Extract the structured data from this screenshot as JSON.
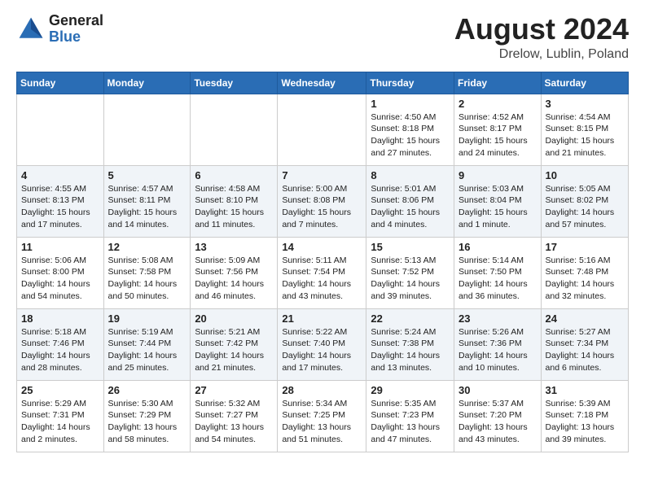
{
  "header": {
    "logo_general": "General",
    "logo_blue": "Blue",
    "title": "August 2024",
    "subtitle": "Drelow, Lublin, Poland"
  },
  "weekdays": [
    "Sunday",
    "Monday",
    "Tuesday",
    "Wednesday",
    "Thursday",
    "Friday",
    "Saturday"
  ],
  "weeks": [
    [
      {
        "day": "",
        "info": ""
      },
      {
        "day": "",
        "info": ""
      },
      {
        "day": "",
        "info": ""
      },
      {
        "day": "",
        "info": ""
      },
      {
        "day": "1",
        "info": "Sunrise: 4:50 AM\nSunset: 8:18 PM\nDaylight: 15 hours\nand 27 minutes."
      },
      {
        "day": "2",
        "info": "Sunrise: 4:52 AM\nSunset: 8:17 PM\nDaylight: 15 hours\nand 24 minutes."
      },
      {
        "day": "3",
        "info": "Sunrise: 4:54 AM\nSunset: 8:15 PM\nDaylight: 15 hours\nand 21 minutes."
      }
    ],
    [
      {
        "day": "4",
        "info": "Sunrise: 4:55 AM\nSunset: 8:13 PM\nDaylight: 15 hours\nand 17 minutes."
      },
      {
        "day": "5",
        "info": "Sunrise: 4:57 AM\nSunset: 8:11 PM\nDaylight: 15 hours\nand 14 minutes."
      },
      {
        "day": "6",
        "info": "Sunrise: 4:58 AM\nSunset: 8:10 PM\nDaylight: 15 hours\nand 11 minutes."
      },
      {
        "day": "7",
        "info": "Sunrise: 5:00 AM\nSunset: 8:08 PM\nDaylight: 15 hours\nand 7 minutes."
      },
      {
        "day": "8",
        "info": "Sunrise: 5:01 AM\nSunset: 8:06 PM\nDaylight: 15 hours\nand 4 minutes."
      },
      {
        "day": "9",
        "info": "Sunrise: 5:03 AM\nSunset: 8:04 PM\nDaylight: 15 hours\nand 1 minute."
      },
      {
        "day": "10",
        "info": "Sunrise: 5:05 AM\nSunset: 8:02 PM\nDaylight: 14 hours\nand 57 minutes."
      }
    ],
    [
      {
        "day": "11",
        "info": "Sunrise: 5:06 AM\nSunset: 8:00 PM\nDaylight: 14 hours\nand 54 minutes."
      },
      {
        "day": "12",
        "info": "Sunrise: 5:08 AM\nSunset: 7:58 PM\nDaylight: 14 hours\nand 50 minutes."
      },
      {
        "day": "13",
        "info": "Sunrise: 5:09 AM\nSunset: 7:56 PM\nDaylight: 14 hours\nand 46 minutes."
      },
      {
        "day": "14",
        "info": "Sunrise: 5:11 AM\nSunset: 7:54 PM\nDaylight: 14 hours\nand 43 minutes."
      },
      {
        "day": "15",
        "info": "Sunrise: 5:13 AM\nSunset: 7:52 PM\nDaylight: 14 hours\nand 39 minutes."
      },
      {
        "day": "16",
        "info": "Sunrise: 5:14 AM\nSunset: 7:50 PM\nDaylight: 14 hours\nand 36 minutes."
      },
      {
        "day": "17",
        "info": "Sunrise: 5:16 AM\nSunset: 7:48 PM\nDaylight: 14 hours\nand 32 minutes."
      }
    ],
    [
      {
        "day": "18",
        "info": "Sunrise: 5:18 AM\nSunset: 7:46 PM\nDaylight: 14 hours\nand 28 minutes."
      },
      {
        "day": "19",
        "info": "Sunrise: 5:19 AM\nSunset: 7:44 PM\nDaylight: 14 hours\nand 25 minutes."
      },
      {
        "day": "20",
        "info": "Sunrise: 5:21 AM\nSunset: 7:42 PM\nDaylight: 14 hours\nand 21 minutes."
      },
      {
        "day": "21",
        "info": "Sunrise: 5:22 AM\nSunset: 7:40 PM\nDaylight: 14 hours\nand 17 minutes."
      },
      {
        "day": "22",
        "info": "Sunrise: 5:24 AM\nSunset: 7:38 PM\nDaylight: 14 hours\nand 13 minutes."
      },
      {
        "day": "23",
        "info": "Sunrise: 5:26 AM\nSunset: 7:36 PM\nDaylight: 14 hours\nand 10 minutes."
      },
      {
        "day": "24",
        "info": "Sunrise: 5:27 AM\nSunset: 7:34 PM\nDaylight: 14 hours\nand 6 minutes."
      }
    ],
    [
      {
        "day": "25",
        "info": "Sunrise: 5:29 AM\nSunset: 7:31 PM\nDaylight: 14 hours\nand 2 minutes."
      },
      {
        "day": "26",
        "info": "Sunrise: 5:30 AM\nSunset: 7:29 PM\nDaylight: 13 hours\nand 58 minutes."
      },
      {
        "day": "27",
        "info": "Sunrise: 5:32 AM\nSunset: 7:27 PM\nDaylight: 13 hours\nand 54 minutes."
      },
      {
        "day": "28",
        "info": "Sunrise: 5:34 AM\nSunset: 7:25 PM\nDaylight: 13 hours\nand 51 minutes."
      },
      {
        "day": "29",
        "info": "Sunrise: 5:35 AM\nSunset: 7:23 PM\nDaylight: 13 hours\nand 47 minutes."
      },
      {
        "day": "30",
        "info": "Sunrise: 5:37 AM\nSunset: 7:20 PM\nDaylight: 13 hours\nand 43 minutes."
      },
      {
        "day": "31",
        "info": "Sunrise: 5:39 AM\nSunset: 7:18 PM\nDaylight: 13 hours\nand 39 minutes."
      }
    ]
  ]
}
